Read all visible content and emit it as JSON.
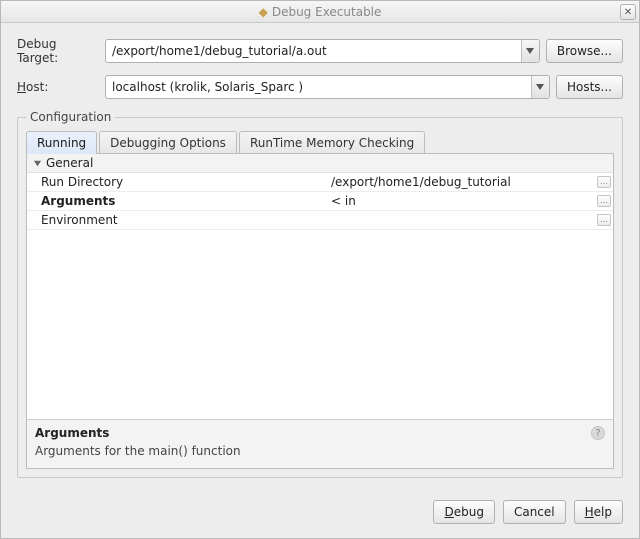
{
  "window": {
    "title": "Debug Executable"
  },
  "form": {
    "debug_target_label": "Debug Target:",
    "debug_target_value": "/export/home1/debug_tutorial/a.out",
    "browse_label": "Browse...",
    "host_label_pre": "H",
    "host_label_post": "ost:",
    "host_value": "localhost (krolik, Solaris_Sparc )",
    "hosts_label": "Hosts..."
  },
  "configuration": {
    "legend": "Configuration",
    "tabs": {
      "running": "Running",
      "debugging": "Debugging Options",
      "runtime": "RunTime Memory Checking"
    },
    "group_general": "General",
    "rows": {
      "run_directory": {
        "name": "Run Directory",
        "value": "/export/home1/debug_tutorial"
      },
      "arguments": {
        "name": "Arguments",
        "value": "< in"
      },
      "environment": {
        "name": "Environment",
        "value": ""
      }
    },
    "description": {
      "title": "Arguments",
      "text": "Arguments for the main() function"
    }
  },
  "buttons": {
    "debug_pre": "D",
    "debug_post": "ebug",
    "cancel": "Cancel",
    "help_pre": "H",
    "help_post": "elp"
  }
}
